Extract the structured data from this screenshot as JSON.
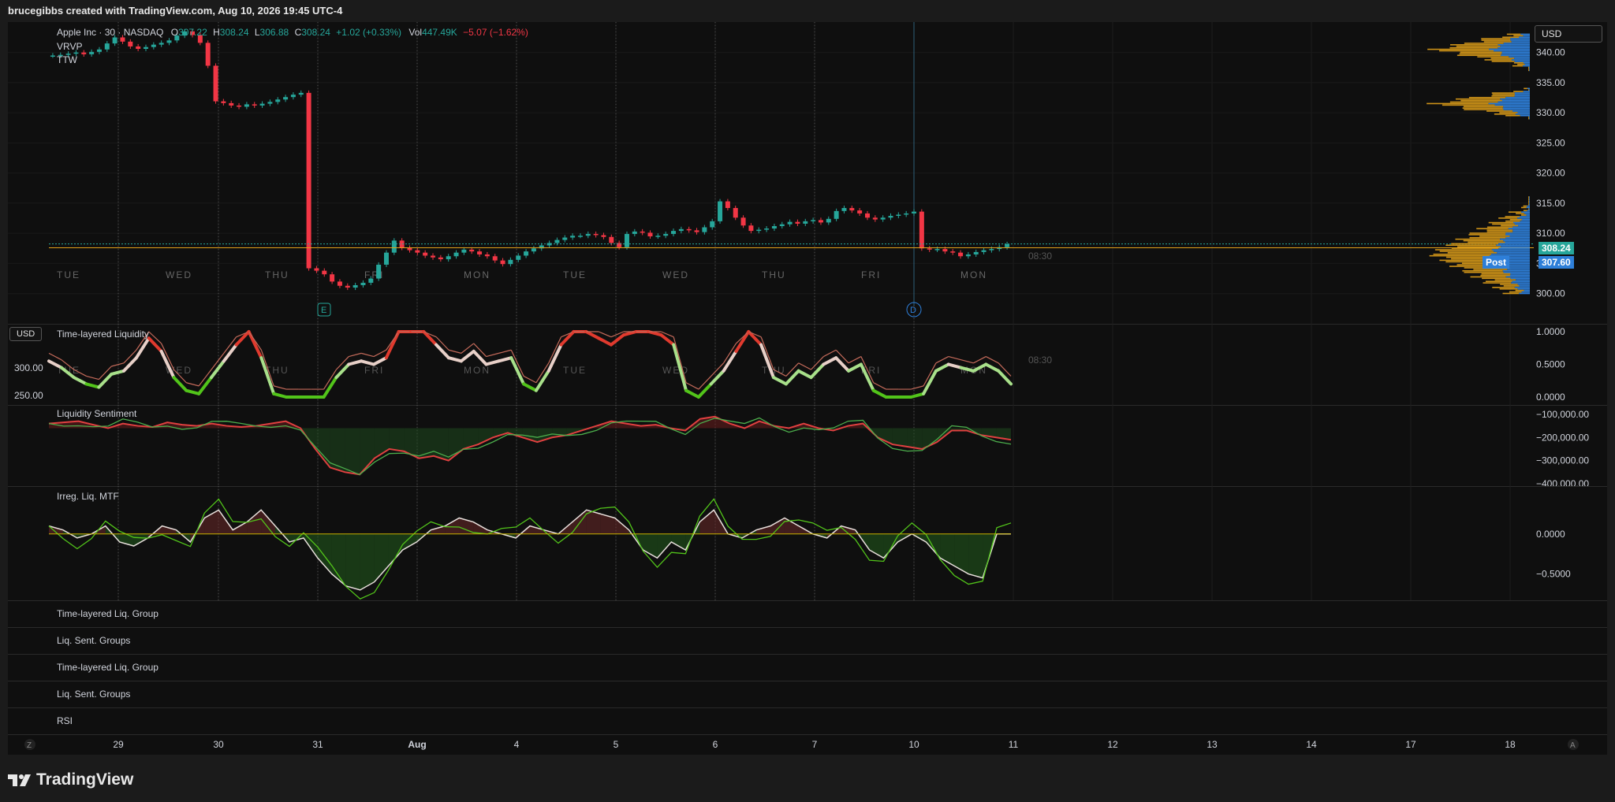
{
  "header": {
    "title": "brucegibbs created with TradingView.com, Aug 10, 2026 19:45 UTC-4"
  },
  "legend": {
    "symbol": "Apple Inc · 30 · NASDAQ",
    "o_label": "O",
    "o": "307.22",
    "h_label": "H",
    "h": "308.24",
    "l_label": "L",
    "l": "306.88",
    "c_label": "C",
    "c": "308.24",
    "change": "+1.02 (+0.33%)",
    "vol_label": "Vol",
    "vol": "447.49K",
    "vol_change": "−5.07 (−1.62%)",
    "indicators": [
      "VRVP",
      "TTW"
    ]
  },
  "currency": "USD",
  "session_time": "08:30",
  "price_labels": {
    "last": "308.24",
    "post_tag": "Post",
    "post": "307.60"
  },
  "panes": {
    "liquidity": {
      "title": "Time-layered Liquidity",
      "currency": "USD",
      "left_ticks": [
        "300.00",
        "250.00"
      ]
    },
    "sentiment": {
      "title": "Liquidity Sentiment"
    },
    "irregular": {
      "title": "Irreg. Liq. MTF"
    },
    "collapsed": [
      "Time-layered Liq. Group",
      "Liq. Sent. Groups",
      "Time-layered Liq. Group",
      "Liq. Sent. Groups",
      "RSI"
    ]
  },
  "markers": {
    "earnings": "E",
    "dividend": "D"
  },
  "corner_buttons": {
    "left": "Z",
    "right": "A"
  },
  "brand": {
    "name": "TradingView"
  },
  "colors": {
    "bg": "#0f0f0f",
    "up": "#26a69a",
    "down": "#f23645",
    "vp_blue": "#2e7fd9",
    "vp_orange": "#e3a21a",
    "liq_red": "#e03a2e",
    "liq_green": "#52c41a"
  },
  "chart_data": [
    {
      "type": "candlestick",
      "x_ticks": [
        "29",
        "30",
        "31",
        "Aug",
        "4",
        "5",
        "6",
        "7",
        "10",
        "11",
        "12",
        "13",
        "14",
        "17",
        "18"
      ],
      "weekday_labels": [
        "TUE",
        "WED",
        "THU",
        "FRI",
        "MON",
        "TUE",
        "WED",
        "THU",
        "FRI",
        "MON"
      ],
      "y_ticks": [
        "340.00",
        "335.00",
        "330.00",
        "325.00",
        "320.00",
        "315.00",
        "310.00",
        "305.00",
        "300.00"
      ],
      "ylim": [
        298,
        344
      ],
      "close_path": [
        339.5,
        339.6,
        339.8,
        340.0,
        339.7,
        340.1,
        340.5,
        341.5,
        342.5,
        341.8,
        341.0,
        340.6,
        340.9,
        341.3,
        341.6,
        342.0,
        342.8,
        343.5,
        342.9,
        341.6,
        337.8,
        331.9,
        331.6,
        331.2,
        331.0,
        331.4,
        331.2,
        331.5,
        331.8,
        332.2,
        332.6,
        333.0,
        333.3,
        304.2,
        303.8,
        303.2,
        302.0,
        301.3,
        301.0,
        301.4,
        301.8,
        302.5,
        304.8,
        306.8,
        308.8,
        307.6,
        307.2,
        306.8,
        306.3,
        306.0,
        305.7,
        306.2,
        306.8,
        307.3,
        307.0,
        306.5,
        306.2,
        305.5,
        304.9,
        305.6,
        306.3,
        307.0,
        307.5,
        308.0,
        308.4,
        308.9,
        309.3,
        309.6,
        309.6,
        309.9,
        309.7,
        309.4,
        308.4,
        307.7,
        309.9,
        310.3,
        310.1,
        309.5,
        309.6,
        309.9,
        310.4,
        310.7,
        310.5,
        310.2,
        311.0,
        312.0,
        315.3,
        314.2,
        312.6,
        311.3,
        310.4,
        310.6,
        310.8,
        311.2,
        311.5,
        311.9,
        311.6,
        312.0,
        312.2,
        311.8,
        312.4,
        313.7,
        314.2,
        313.8,
        313.3,
        312.6,
        312.3,
        312.6,
        312.9,
        313.1,
        313.3,
        313.6,
        307.5,
        307.3,
        307.4,
        307.0,
        306.8,
        306.2,
        306.5,
        306.9,
        307.2,
        307.4,
        307.7,
        308.2
      ],
      "last": 308.24,
      "post": 307.6
    },
    {
      "type": "area",
      "name": "Time-layered Liquidity",
      "y_ticks": [
        "1.0000",
        "0.5000",
        "0.0000"
      ],
      "ylim": [
        0,
        1
      ],
      "values": [
        0.55,
        0.45,
        0.3,
        0.2,
        0.15,
        0.35,
        0.4,
        0.6,
        0.9,
        0.7,
        0.3,
        0.1,
        0.05,
        0.3,
        0.55,
        0.8,
        1.0,
        0.6,
        0.05,
        0.0,
        0.0,
        0.0,
        0.0,
        0.3,
        0.5,
        0.55,
        0.5,
        0.6,
        1.0,
        1.0,
        1.0,
        0.8,
        0.6,
        0.55,
        0.7,
        0.5,
        0.55,
        0.6,
        0.2,
        0.1,
        0.4,
        0.8,
        1.0,
        1.0,
        0.9,
        0.8,
        0.95,
        1.0,
        1.0,
        0.95,
        0.8,
        0.1,
        0.0,
        0.2,
        0.4,
        0.7,
        1.0,
        0.8,
        0.3,
        0.2,
        0.4,
        0.3,
        0.5,
        0.6,
        0.4,
        0.5,
        0.1,
        0.0,
        0.0,
        0.0,
        0.05,
        0.4,
        0.5,
        0.45,
        0.4,
        0.5,
        0.4,
        0.2
      ]
    },
    {
      "type": "area",
      "name": "Liquidity Sentiment",
      "y_ticks": [
        "−100,000.00",
        "−200,000.00",
        "−300,000.00",
        "−400,000.00"
      ],
      "ylim": [
        -400000,
        -80000
      ],
      "values": [
        -140000,
        -135000,
        -130000,
        -145000,
        -160000,
        -140000,
        -150000,
        -155000,
        -135000,
        -145000,
        -150000,
        -140000,
        -150000,
        -155000,
        -150000,
        -140000,
        -130000,
        -160000,
        -250000,
        -330000,
        -350000,
        -360000,
        -290000,
        -250000,
        -260000,
        -290000,
        -280000,
        -300000,
        -250000,
        -230000,
        -200000,
        -180000,
        -200000,
        -220000,
        -200000,
        -190000,
        -170000,
        -150000,
        -130000,
        -140000,
        -150000,
        -145000,
        -160000,
        -170000,
        -120000,
        -110000,
        -140000,
        -160000,
        -130000,
        -150000,
        -160000,
        -140000,
        -160000,
        -170000,
        -150000,
        -140000,
        -200000,
        -230000,
        -240000,
        -250000,
        -220000,
        -170000,
        -170000,
        -190000,
        -200000,
        -210000
      ]
    },
    {
      "type": "area",
      "name": "Irreg. Liq. MTF",
      "y_ticks": [
        "0.0000",
        "−0.5000"
      ],
      "ylim": [
        -0.78,
        0.5
      ],
      "values": [
        0.1,
        0.05,
        -0.05,
        0.0,
        0.1,
        -0.1,
        -0.15,
        -0.05,
        0.1,
        0.05,
        -0.1,
        0.2,
        0.3,
        0.05,
        0.15,
        0.3,
        0.1,
        -0.1,
        -0.05,
        -0.3,
        -0.5,
        -0.65,
        -0.7,
        -0.6,
        -0.4,
        -0.2,
        -0.1,
        0.05,
        0.1,
        0.2,
        0.15,
        0.05,
        0.0,
        -0.05,
        0.1,
        0.05,
        0.0,
        0.15,
        0.3,
        0.25,
        0.2,
        0.05,
        -0.2,
        -0.3,
        -0.1,
        -0.2,
        0.15,
        0.3,
        0.0,
        -0.05,
        0.05,
        0.1,
        0.2,
        0.1,
        0.0,
        -0.05,
        0.1,
        0.05,
        -0.2,
        -0.3,
        -0.1,
        0.0,
        -0.1,
        -0.3,
        -0.4,
        -0.5,
        -0.55,
        0.0,
        0.0
      ]
    }
  ]
}
